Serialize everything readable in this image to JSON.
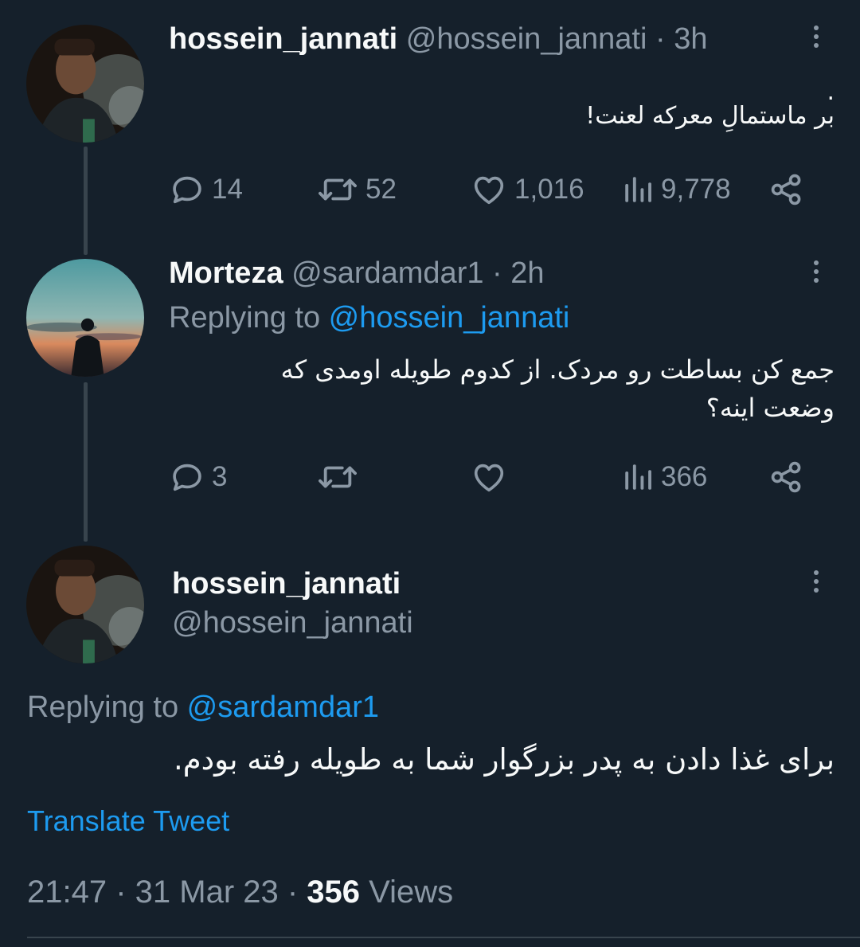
{
  "tweet1": {
    "display_name": "hossein_jannati",
    "handle": "@hossein_jannati",
    "time": "· 3h",
    "dot": ".",
    "text": "بر ماستمالِ معرکه لعنت!",
    "replies": "14",
    "retweets": "52",
    "likes": "1,016",
    "views": "9,778"
  },
  "tweet2": {
    "display_name": "Morteza",
    "handle": "@sardamdar1",
    "time": "· 2h",
    "replying_prefix": "Replying to ",
    "replying_to": "@hossein_jannati",
    "text_line1": "جمع کن بساطت رو مردک. از کدوم طویله اومدی که",
    "text_line2": "وضعت اینه؟",
    "replies": "3",
    "retweets": "",
    "likes": "",
    "views": "366"
  },
  "main_tweet": {
    "display_name": "hossein_jannati",
    "handle": "@hossein_jannati",
    "replying_prefix": "Replying to ",
    "replying_to": "@sardamdar1",
    "text": "برای غذا دادن به پدر بزرگوار شما به طویله رفته بودم.",
    "translate": "Translate Tweet",
    "timestamp": "21:47 · 31 Mar 23 · ",
    "views_count": "356",
    "views_label": " Views"
  },
  "icons": {
    "reply": "reply-icon",
    "retweet": "retweet-icon",
    "like": "heart-icon",
    "views": "views-icon",
    "share": "share-icon",
    "more": "more-icon"
  },
  "colors": {
    "background": "#15202b",
    "accent": "#1d9bf0",
    "muted": "#8b98a5",
    "text": "#f7f9f9"
  }
}
